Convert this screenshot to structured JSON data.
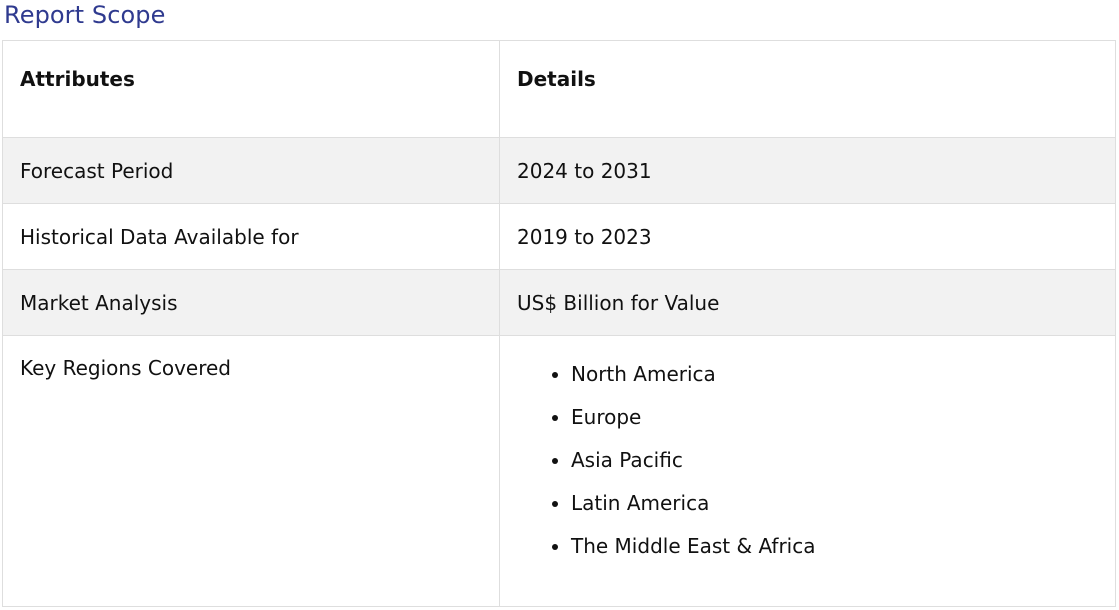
{
  "title": "Report Scope",
  "table": {
    "headers": {
      "attributes": "Attributes",
      "details": "Details"
    },
    "rows": [
      {
        "attribute": "Forecast Period",
        "detail": "2024 to 2031"
      },
      {
        "attribute": "Historical Data Available for",
        "detail": "2019 to 2023"
      },
      {
        "attribute": "Market Analysis",
        "detail": "US$ Billion for Value"
      }
    ],
    "regions": {
      "attribute": "Key Regions Covered",
      "items": [
        "North America",
        "Europe",
        "Asia Pacific",
        "Latin America",
        "The Middle East & Africa"
      ]
    }
  }
}
